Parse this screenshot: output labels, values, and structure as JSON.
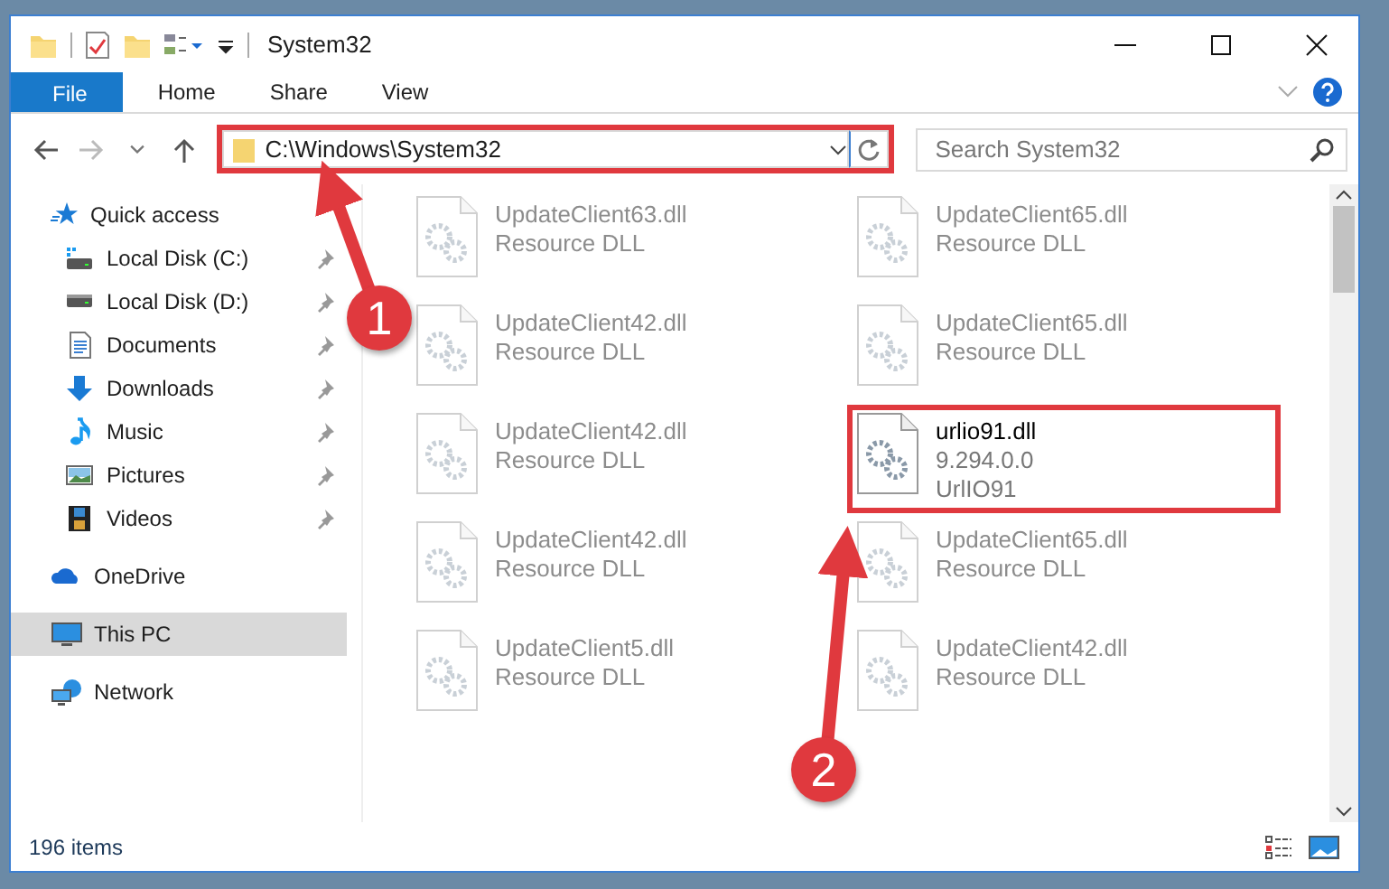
{
  "window": {
    "title": "System32"
  },
  "ribbon_tabs": [
    {
      "label": "File",
      "kind": "file"
    },
    {
      "label": "Home",
      "kind": "tab"
    },
    {
      "label": "Share",
      "kind": "tab"
    },
    {
      "label": "View",
      "kind": "tab"
    }
  ],
  "address": {
    "path": "C:\\Windows\\System32",
    "annotated": true
  },
  "search": {
    "placeholder": "Search System32"
  },
  "navigation": [
    {
      "label": "Quick access",
      "kind": "star",
      "selected": false,
      "children": [
        {
          "label": "Local Disk (C:)",
          "kind": "system-drive",
          "pinned": true
        },
        {
          "label": "Local Disk (D:)",
          "kind": "drive",
          "pinned": true
        },
        {
          "label": "Documents",
          "kind": "documents",
          "pinned": true
        },
        {
          "label": "Downloads",
          "kind": "downloads",
          "pinned": true
        },
        {
          "label": "Music",
          "kind": "music",
          "pinned": true
        },
        {
          "label": "Pictures",
          "kind": "pictures",
          "pinned": true
        },
        {
          "label": "Videos",
          "kind": "videos",
          "pinned": true
        }
      ]
    },
    {
      "label": "OneDrive",
      "kind": "cloud",
      "selected": false
    },
    {
      "label": "This PC",
      "kind": "pc",
      "selected": true
    },
    {
      "label": "Network",
      "kind": "network",
      "selected": false
    }
  ],
  "files": [
    {
      "name": "UpdateClient63.dll",
      "lines": [
        "Resource DLL"
      ],
      "blurred": true
    },
    {
      "name": "UpdateClient65.dll",
      "lines": [
        "Resource DLL"
      ],
      "blurred": true
    },
    {
      "name": "UpdateClient42.dll",
      "lines": [
        "Resource DLL"
      ],
      "blurred": true
    },
    {
      "name": "UpdateClient65.dll",
      "lines": [
        "Resource DLL"
      ],
      "blurred": true
    },
    {
      "name": "UpdateClient42.dll",
      "lines": [
        "Resource DLL"
      ],
      "blurred": true
    },
    {
      "name": "urlio91.dll",
      "lines": [
        "9.294.0.0",
        "UrlIO91"
      ],
      "blurred": false,
      "annotated": true
    },
    {
      "name": "UpdateClient42.dll",
      "lines": [
        "Resource DLL"
      ],
      "blurred": true
    },
    {
      "name": "UpdateClient65.dll",
      "lines": [
        "Resource DLL"
      ],
      "blurred": true
    },
    {
      "name": "UpdateClient5.dll",
      "lines": [
        "Resource DLL"
      ],
      "blurred": true
    },
    {
      "name": "UpdateClient42.dll",
      "lines": [
        "Resource DLL"
      ],
      "blurred": true
    }
  ],
  "callouts": [
    {
      "number": "1"
    },
    {
      "number": "2"
    }
  ],
  "status_bar": {
    "item_count": "196 items"
  }
}
